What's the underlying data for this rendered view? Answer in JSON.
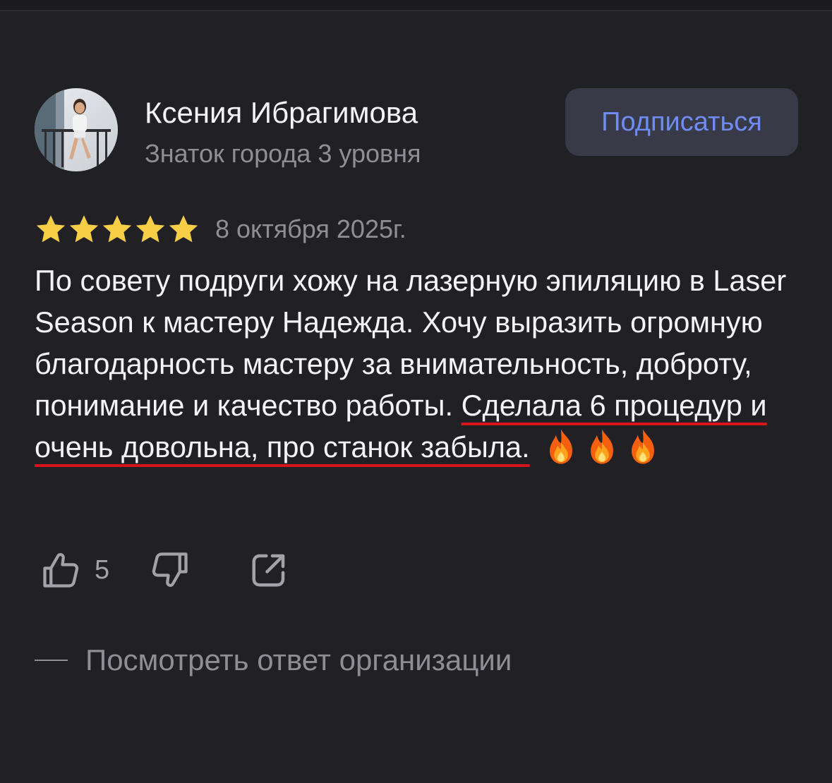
{
  "author": {
    "name": "Ксения Ибрагимова",
    "level": "Знаток города 3 уровня"
  },
  "subscribe": {
    "label": "Подписаться"
  },
  "review": {
    "rating": 5,
    "max_rating": 5,
    "date": "8 октября 2025г.",
    "text_before": "По совету подруги хожу на лазерную эпиляцию в Laser Season к мастеру Надежда. Хочу выразить огромную благодарность мастеру за внимательность, доброту, понимание и качество работы. ",
    "text_highlighted": "Сделала 6 процедур и очень довольна, про станок забыла.",
    "emoji": [
      "fire-icon",
      "fire-icon",
      "fire-icon"
    ]
  },
  "actions": {
    "like_count": "5"
  },
  "org_reply": {
    "label": "Посмотреть ответ организации"
  },
  "colors": {
    "background": "#212125",
    "star": "#f7cf46",
    "accent_link": "#6f8cf3",
    "underline": "#d7141c",
    "secondary_text": "#8e8e95"
  },
  "icons": {
    "like": "thumbs-up-icon",
    "dislike": "thumbs-down-icon",
    "share": "share-icon",
    "star": "star-icon"
  }
}
